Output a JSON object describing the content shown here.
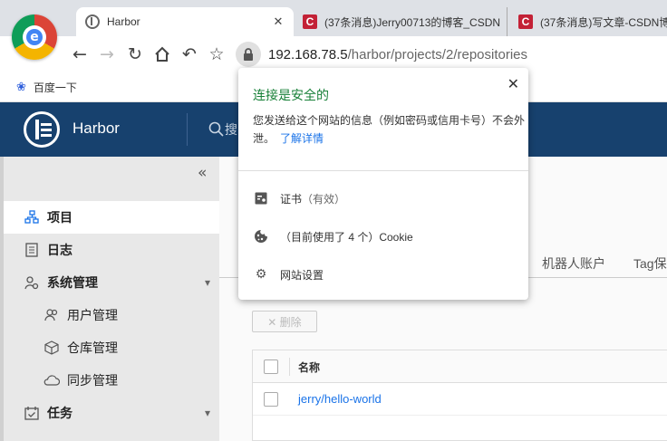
{
  "browser": {
    "tabs": [
      {
        "title": "Harbor",
        "icon": "harbor-favicon",
        "active": true
      },
      {
        "title": "(37条消息)Jerry00713的博客_CSDN",
        "icon": "csdn-favicon",
        "active": false
      },
      {
        "title": "(37条消息)写文章-CSDN博",
        "icon": "csdn-favicon",
        "active": false
      }
    ],
    "tab_close": "✕",
    "url_host": "192.168.78.5",
    "url_path": "/harbor/projects/2/repositories",
    "bookmark": "百度一下"
  },
  "popup": {
    "title": "连接是安全的",
    "close": "✕",
    "description": "您发送给这个网站的信息（例如密码或信用卡号）不会外泄。",
    "learn_more": "了解详情",
    "rows": [
      {
        "icon": "certificate-icon",
        "label": "证书",
        "suffix": "（有效）"
      },
      {
        "icon": "cookie-icon",
        "label": "（目前使用了 4 个）Cookie",
        "suffix": ""
      },
      {
        "icon": "gear-icon",
        "label": "网站设置",
        "suffix": ""
      }
    ]
  },
  "harbor": {
    "brand": "Harbor",
    "search_hint": "搜",
    "collapse": "«",
    "sidebar": [
      {
        "label": "项目",
        "icon": "projects-icon",
        "active": true,
        "bold": true
      },
      {
        "label": "日志",
        "icon": "logs-icon",
        "bold": true
      },
      {
        "label": "系统管理",
        "icon": "admin-icon",
        "bold": true,
        "expandable": true
      },
      {
        "label": "用户管理",
        "icon": "users-icon",
        "sub": true
      },
      {
        "label": "仓库管理",
        "icon": "registry-icon",
        "sub": true
      },
      {
        "label": "同步管理",
        "icon": "replication-icon",
        "sub": true
      },
      {
        "label": "任务",
        "icon": "tasks-icon",
        "bold": true,
        "expandable": true
      }
    ],
    "main_tabs": [
      "机器人账户",
      "Tag保"
    ],
    "delete_label": "✕ 删除",
    "table": {
      "header_name": "名称",
      "rows": [
        {
          "name": "jerry/hello-world"
        }
      ]
    }
  },
  "colors": {
    "secure_green": "#188038",
    "harbor_navy": "#17416e",
    "link_blue": "#1a73e8"
  }
}
